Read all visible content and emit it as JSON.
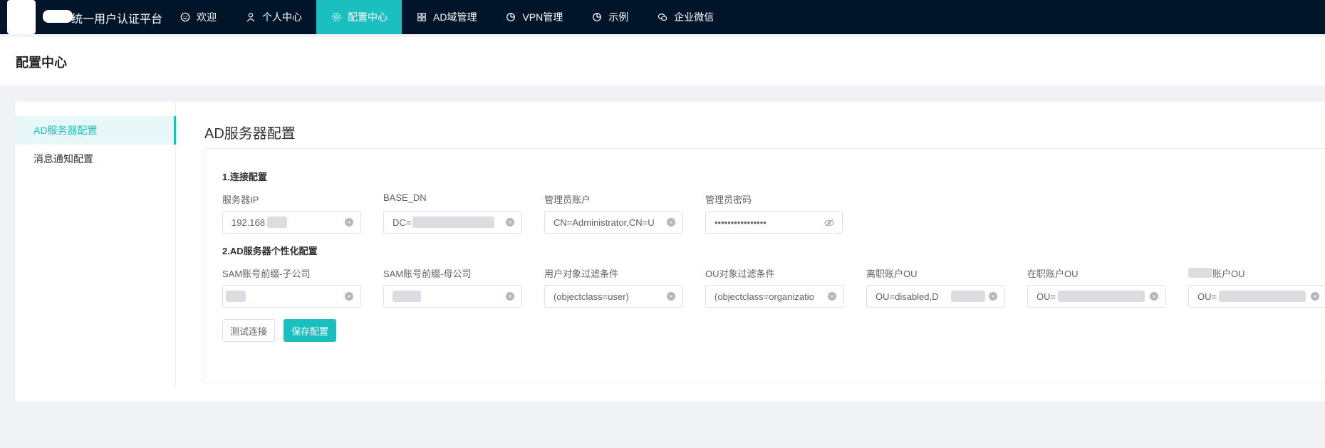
{
  "app": {
    "title": "统一用户认证平台"
  },
  "nav": [
    {
      "label": "欢迎",
      "icon": "smile-icon"
    },
    {
      "label": "个人中心",
      "icon": "user-icon"
    },
    {
      "label": "配置中心",
      "icon": "gear-icon",
      "active": true
    },
    {
      "label": "AD域管理",
      "icon": "grid-icon"
    },
    {
      "label": "VPN管理",
      "icon": "pie-icon"
    },
    {
      "label": "示例",
      "icon": "pie-icon"
    },
    {
      "label": "企业微信",
      "icon": "wechat-icon"
    }
  ],
  "page": {
    "title": "配置中心"
  },
  "side": {
    "items": [
      {
        "label": "AD服务器配置",
        "active": true
      },
      {
        "label": "消息通知配置"
      }
    ]
  },
  "content": {
    "title": "AD服务器配置",
    "section1": "1.连接配置",
    "section2": "2.AD服务器个性化配置"
  },
  "fields": {
    "server_ip": {
      "label": "服务器IP",
      "value": "192.168"
    },
    "base_dn": {
      "label": "BASE_DN",
      "value": "DC="
    },
    "admin_account": {
      "label": "管理员账户",
      "value": "CN=Administrator,CN=U"
    },
    "admin_password": {
      "label": "管理员密码",
      "value": "••••••••••••••••"
    },
    "sam_sub": {
      "label": "SAM账号前缀-子公司",
      "value": ""
    },
    "sam_parent": {
      "label": "SAM账号前缀-母公司",
      "value": ""
    },
    "user_filter": {
      "label": "用户对象过滤条件",
      "value": "(objectclass=user)"
    },
    "ou_filter": {
      "label": "OU对象过滤条件",
      "value": "(objectclass=organizatio"
    },
    "disabled_ou": {
      "label": "离职账户OU",
      "value": "OU=disabled,D"
    },
    "active_ou": {
      "label": "在职账户OU",
      "value": "OU="
    },
    "other_ou": {
      "label": "账户OU",
      "value": "OU="
    }
  },
  "buttons": {
    "test": "测试连接",
    "save": "保存配置"
  },
  "colors": {
    "nav_bg": "#001529",
    "accent": "#1abfbf"
  }
}
